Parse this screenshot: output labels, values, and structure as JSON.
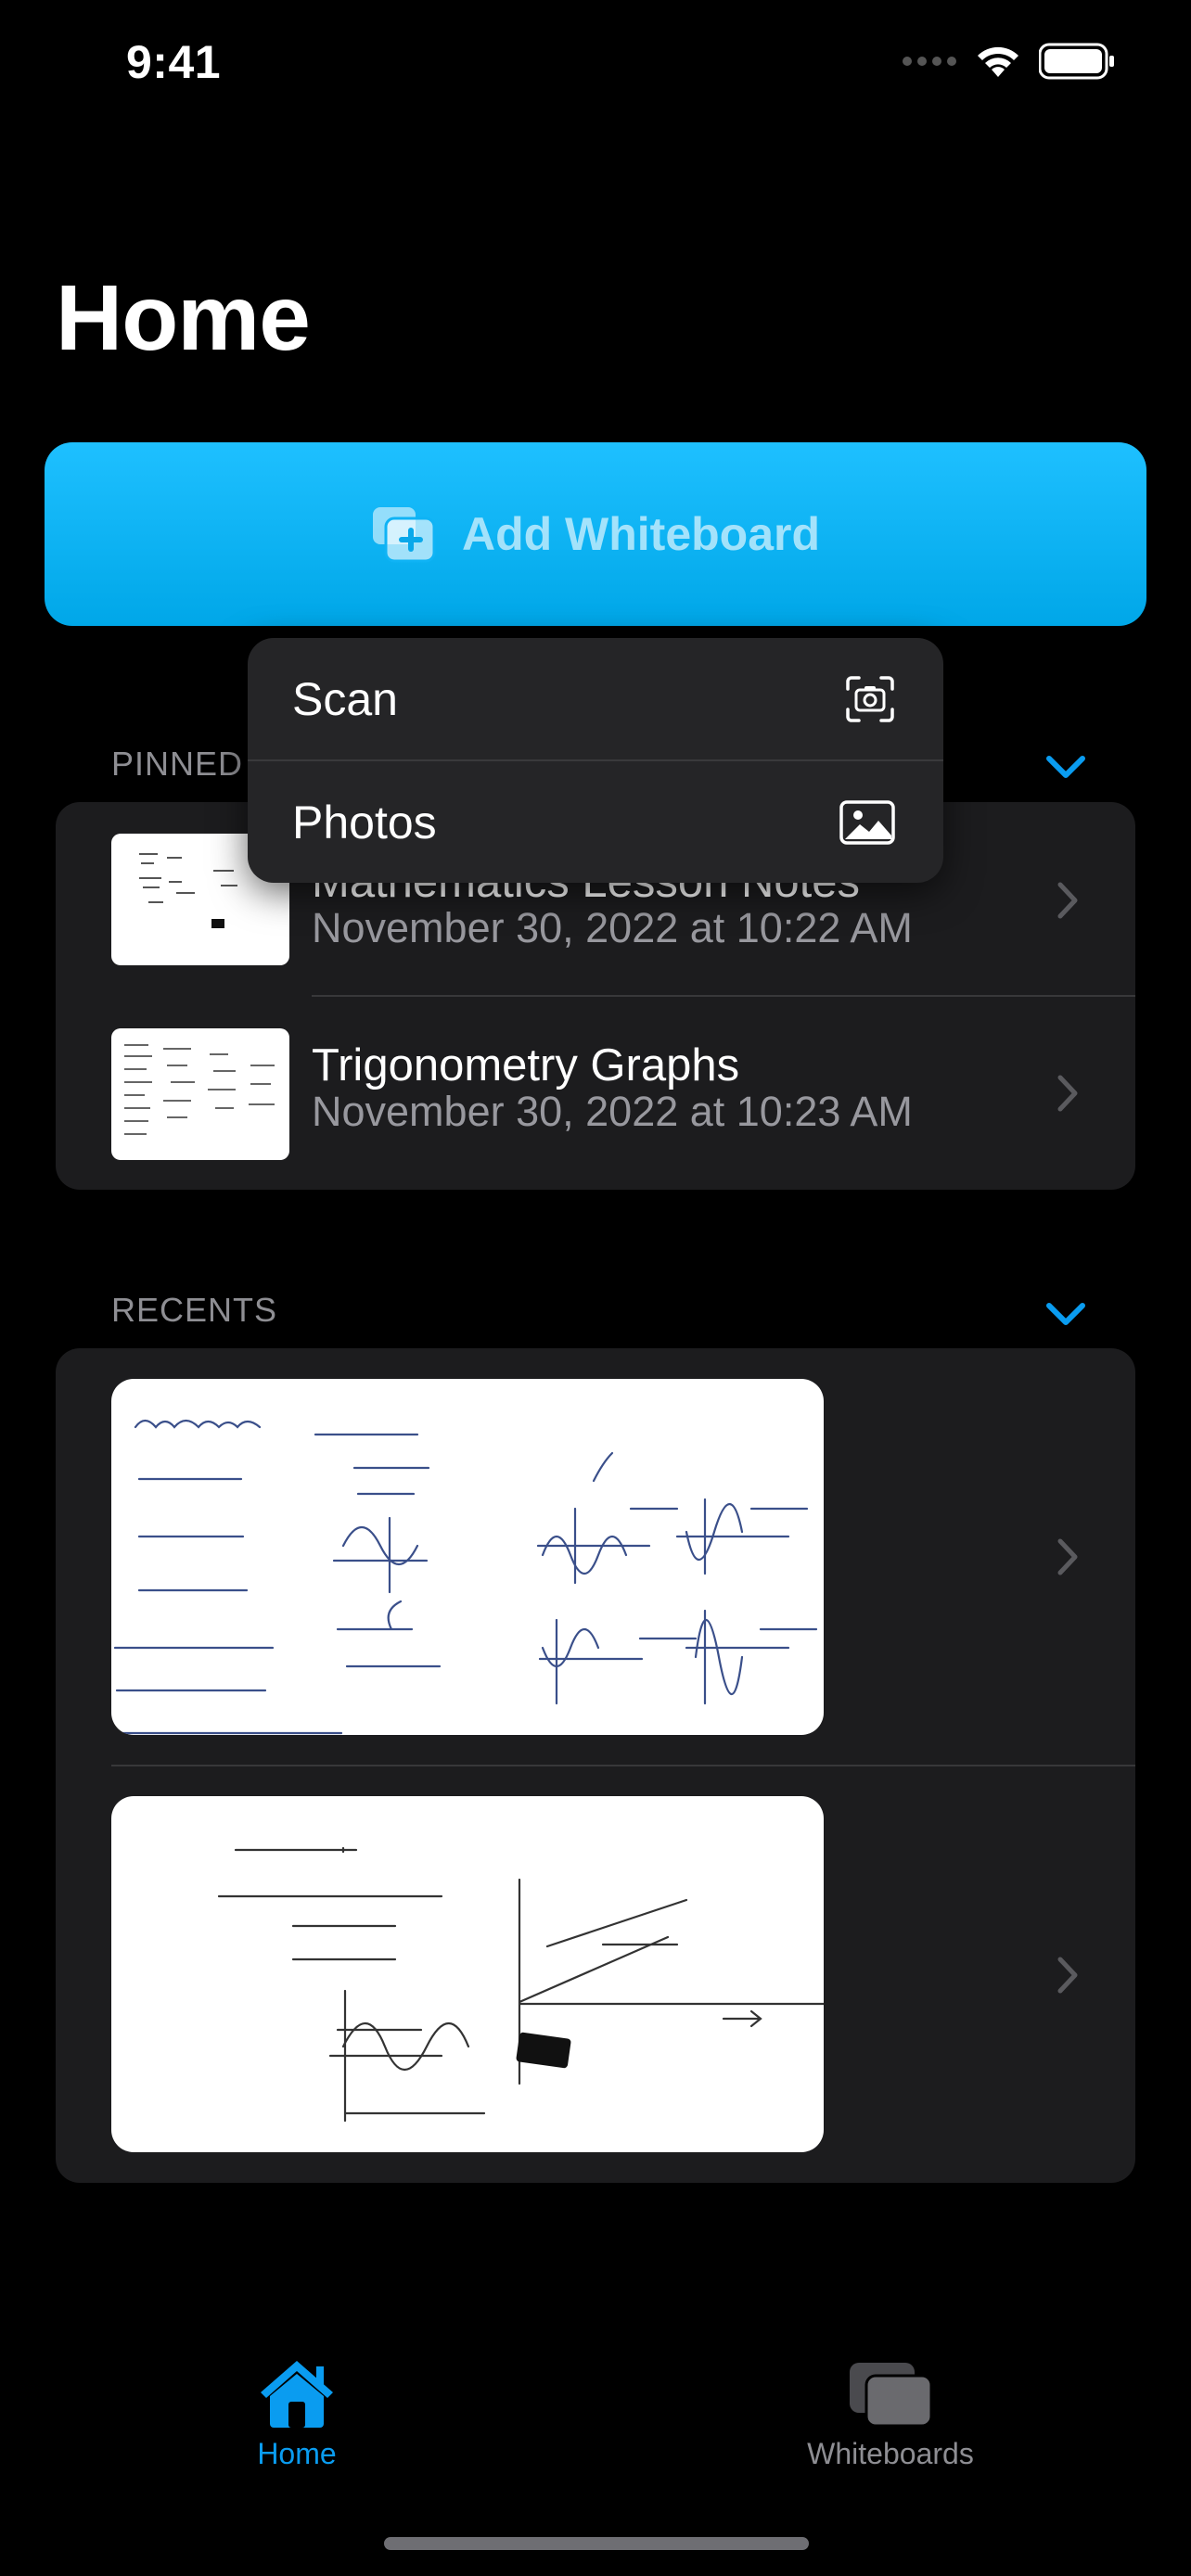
{
  "status_bar": {
    "time": "9:41"
  },
  "header": {
    "title": "Home"
  },
  "add_button": {
    "label": "Add Whiteboard"
  },
  "context_menu": {
    "items": [
      {
        "label": "Scan",
        "icon": "camera-viewfinder-icon"
      },
      {
        "label": "Photos",
        "icon": "photo-icon"
      }
    ]
  },
  "pinned": {
    "header": "PINNED",
    "items": [
      {
        "title": "Mathematics Lesson Notes",
        "date": "November 30, 2022 at 10:22 AM"
      },
      {
        "title": "Trigonometry Graphs",
        "date": "November 30, 2022 at 10:23 AM"
      }
    ]
  },
  "recents": {
    "header": "RECENTS",
    "items": [
      {
        "thumbnail": "trigonometry-whiteboard-thumbnail"
      },
      {
        "thumbnail": "quadratic-whiteboard-thumbnail"
      }
    ]
  },
  "tab_bar": {
    "tabs": [
      {
        "label": "Home",
        "icon": "house-icon",
        "active": true
      },
      {
        "label": "Whiteboards",
        "icon": "stacked-rectangles-icon",
        "active": false
      }
    ]
  },
  "colors": {
    "accent": "#0a9cf0",
    "button_gradient_top": "#1ec0ff",
    "button_gradient_bottom": "#00a7e8",
    "background": "#000000",
    "card": "#1c1c1e",
    "secondary_text": "#98989e"
  }
}
